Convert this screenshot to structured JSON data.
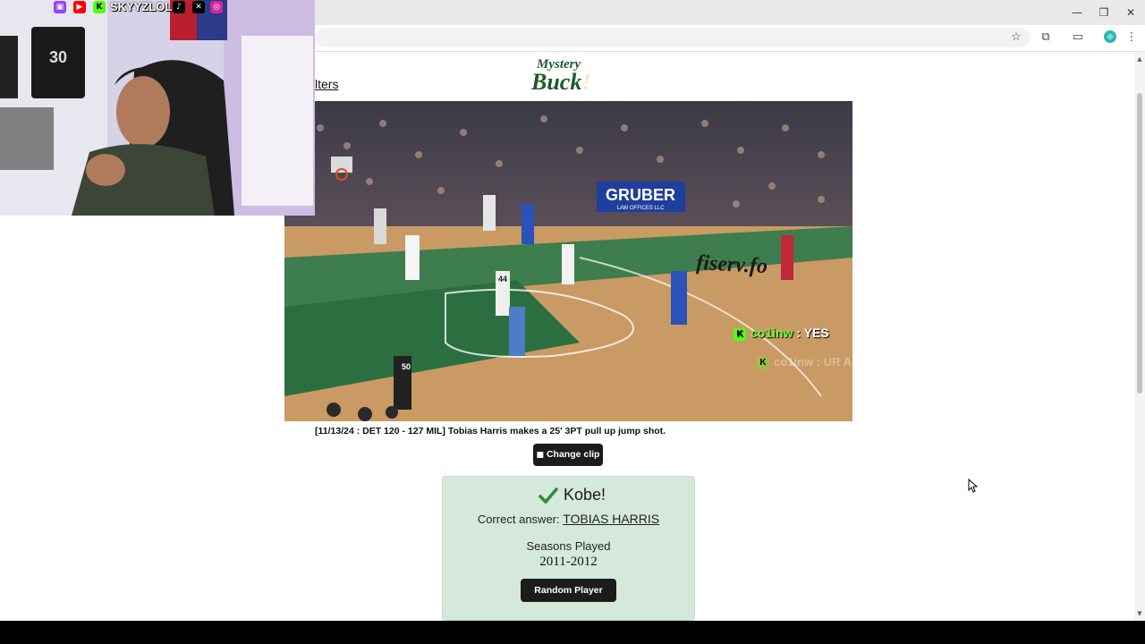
{
  "browser": {
    "minimize": "—",
    "restore": "❐",
    "close": "✕"
  },
  "stream": {
    "handle": "SKYYZLOL",
    "jersey_number": "30"
  },
  "page": {
    "filters_label": "lters",
    "logo_top": "Mystery",
    "logo_bottom": "Buck",
    "logo_mark": "!",
    "video": {
      "sponsor": "GRUBER",
      "sponsor_sub": "LAW OFFICES LLC",
      "court_text": "fiserv.fo",
      "ref_number": "50",
      "player_number": "44"
    },
    "caption": "[11/13/24 : DET 120 - 127 MIL] Tobias Harris makes a 25' 3PT pull up jump shot.",
    "change_clip_label": "Change clip",
    "result": {
      "title": "Kobe!",
      "correct_label": "Correct answer:",
      "correct_answer": "TOBIAS HARRIS",
      "seasons_label": "Seasons Played",
      "seasons_value": "2011-2012",
      "random_player_label": "Random Player"
    }
  },
  "chat": [
    {
      "user": "co1inw",
      "message": "YES"
    },
    {
      "user": "co1inw",
      "message": "UR A BITCH"
    }
  ]
}
